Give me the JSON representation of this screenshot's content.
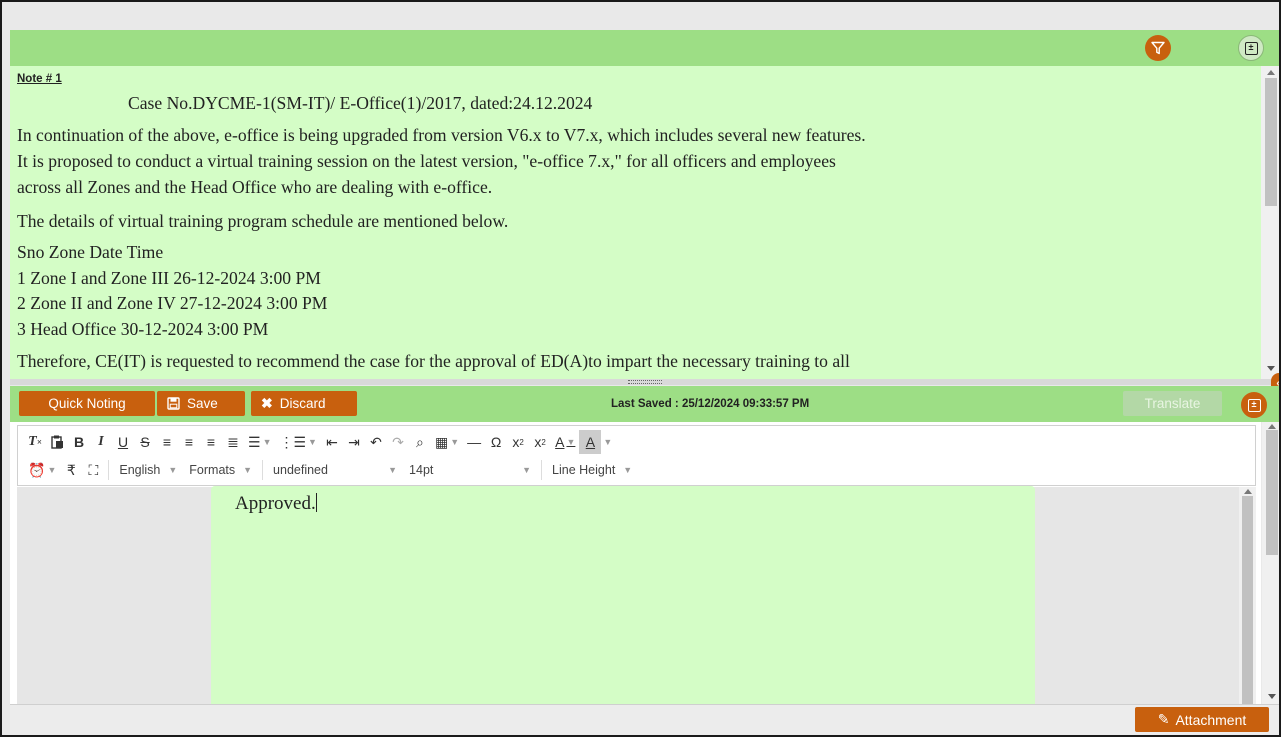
{
  "header": {
    "filter_icon": "filter-icon",
    "expand_icon": "expand-icon"
  },
  "note": {
    "label": "Note # 1",
    "subject": "Case No.DYCME-1(SM-IT)/ E-Office(1)/2017, dated:24.12.2024",
    "paragraphs": [
      "In continuation of the above, e-office is being upgraded from version V6.x to V7.x, which includes several new features.",
      "It is proposed to conduct a virtual training session on the latest version, \"e-office 7.x,\" for all officers and employees",
      "across all Zones and the Head Office who are dealing with e-office."
    ],
    "schedule_intro": "The details of virtual training program schedule are mentioned below.",
    "schedule_header": "Sno Zone Date Time",
    "schedule_rows": [
      "1 Zone I and Zone III 26-12-2024 3:00 PM",
      "2 Zone II and Zone IV 27-12-2024 3:00 PM",
      "3 Head Office 30-12-2024 3:00 PM"
    ],
    "closing": "Therefore, CE(IT) is requested to recommend the case for the approval of ED(A)to impart the necessary training to all"
  },
  "actions": {
    "quick_noting": "Quick Noting",
    "save": "Save",
    "discard": "Discard",
    "last_saved": "Last Saved : 25/12/2024 09:33:57 PM",
    "translate": "Translate"
  },
  "toolbar": {
    "language": "English",
    "formats": "Formats",
    "font_family": "undefined",
    "font_size": "14pt",
    "line_height": "Line Height",
    "rupee": "₹"
  },
  "editor": {
    "content": "Approved."
  },
  "footer": {
    "attachment": "Attachment"
  },
  "colors": {
    "header_green": "#9dde85",
    "note_green": "#d4fdc6",
    "accent_orange": "#c8600e"
  }
}
